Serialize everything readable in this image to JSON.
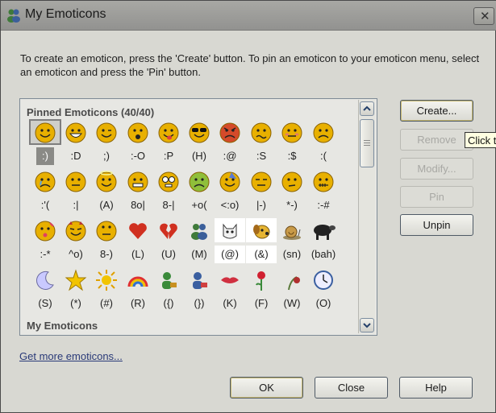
{
  "window": {
    "title": "My Emoticons",
    "close_glyph": "✕"
  },
  "instructions": "To create an emoticon, press the 'Create' button.  To pin an emoticon to your emoticon menu, select an emoticon and press the 'Pin' button.",
  "pinned_header": "Pinned Emoticons (40/40)",
  "my_header": "My Emoticons",
  "rows": [
    {
      "icons": [
        "smile",
        "big-grin",
        "wink",
        "surprised",
        "tongue-out",
        "sunglasses",
        "angry",
        "confused",
        "embarrassed",
        "sad"
      ],
      "codes": [
        ":)",
        ":D",
        ";)",
        ":-O",
        ":P",
        "(H)",
        ":@",
        ":S",
        ":$",
        ":("
      ]
    },
    {
      "icons": [
        "crying",
        "disappointed",
        "angel",
        "baring-teeth",
        "nerd",
        "sick",
        "party",
        "sarcastic",
        "thinking",
        "secret"
      ],
      "codes": [
        ":'(",
        ":|",
        "(A)",
        "8o|",
        "8-|",
        "+o(",
        "<:o)",
        "|-)",
        "*-)",
        ":-#"
      ]
    },
    {
      "icons": [
        "kiss",
        "devil",
        "eye-roll",
        "red-heart",
        "broken-heart",
        "msn-buddies",
        "cat",
        "dog",
        "snail",
        "black-sheep"
      ],
      "codes": [
        ":-*",
        "^o)",
        "8-)",
        "(L)",
        "(U)",
        "(M)",
        "(@)",
        "(&)",
        "(sn)",
        "(bah)"
      ]
    },
    {
      "icons": [
        "moon",
        "star",
        "sun",
        "rainbow",
        "boy",
        "girl",
        "lips",
        "red-rose",
        "wilted-rose",
        "clock"
      ],
      "codes": [
        "(S)",
        "(*)",
        "(#)",
        "(R)",
        "({)",
        "(})",
        "(K)",
        "(F)",
        "(W)",
        "(O)"
      ]
    }
  ],
  "buttons": {
    "create": "Create...",
    "remove": "Remove",
    "modify": "Modify...",
    "pin": "Pin",
    "unpin": "Unpin",
    "ok": "OK",
    "close": "Close",
    "help": "Help"
  },
  "tooltip": "Click to",
  "link": "Get more emoticons...",
  "colors": {
    "face": "#e8b000",
    "face_edge": "#8a6200",
    "heart": "#d03020"
  }
}
